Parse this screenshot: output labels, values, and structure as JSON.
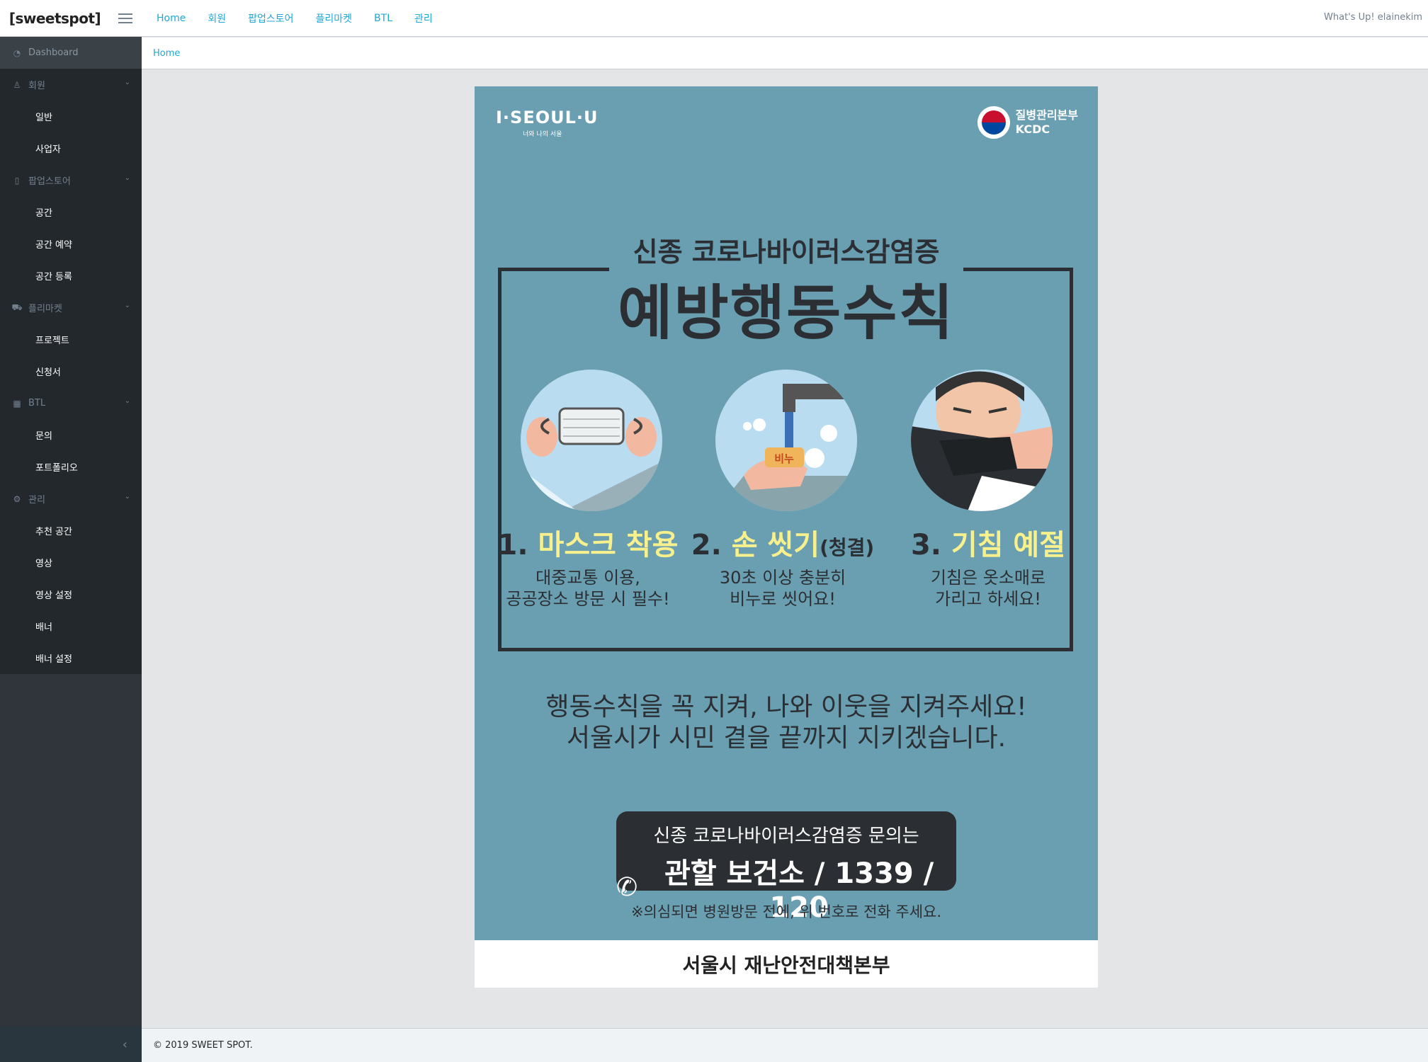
{
  "brand": "[sweetspot]",
  "topnav": [
    "Home",
    "회원",
    "팝업스토어",
    "플리마켓",
    "BTL",
    "관리"
  ],
  "greeting": "What's Up! elainekim",
  "sidebar": {
    "dashboard": "Dashboard",
    "groups": [
      {
        "label": "회원",
        "icon": "user-icon",
        "children": [
          "일반",
          "사업자"
        ]
      },
      {
        "label": "팝업스토어",
        "icon": "building-icon",
        "children": [
          "공간",
          "공간 예약",
          "공간 등록"
        ]
      },
      {
        "label": "플리마켓",
        "icon": "cart-icon",
        "children": [
          "프로젝트",
          "신청서"
        ]
      },
      {
        "label": "BTL",
        "icon": "grid-icon",
        "children": [
          "문의",
          "포트폴리오"
        ]
      },
      {
        "label": "관리",
        "icon": "gear-icon",
        "children": [
          "추천 공간",
          "영상",
          "영상 설정",
          "배너",
          "배너 설정"
        ]
      }
    ]
  },
  "breadcrumb": "Home",
  "poster": {
    "logo_left": "I·SEOUL·U",
    "logo_left_sub": "너와 나의 서울",
    "logo_right_line1": "질병관리본부",
    "logo_right_line2": "KCDC",
    "title_small": "신종 코로나바이러스감염증",
    "title_big": "예방행동수칙",
    "steps": [
      {
        "num": "1.",
        "title": "마스크 착용",
        "desc1": "대중교통 이용,",
        "desc2": "공공장소 방문 시 필수!"
      },
      {
        "num": "2.",
        "title": "손 씻기",
        "extra": "(청결)",
        "desc1": "30초 이상 충분히",
        "desc2": "비누로 씻어요!"
      },
      {
        "num": "3.",
        "title": "기침 예절",
        "desc1": "기침은 옷소매로",
        "desc2": "가리고 하세요!"
      }
    ],
    "soap_label": "비누",
    "message1": "행동수칙을 꼭 지켜, 나와 이웃을 지켜주세요!",
    "message2": "서울시가 시민 곁을 끝까지 지키겠습니다.",
    "hotline_line1": "신종 코로나바이러스감염증 문의는",
    "hotline_line2": "관할 보건소 / 1339 / 120",
    "note": "※의심되면 병원방문 전에, 위 번호로 전화 주세요.",
    "bottom": "서울시 재난안전대책본부"
  },
  "footer": "© 2019 SWEET SPOT.",
  "colors": {
    "accent": "#20a8d8",
    "sidebar": "#2f353a",
    "poster_bg": "#699fb1",
    "highlight": "#f7f08c"
  }
}
